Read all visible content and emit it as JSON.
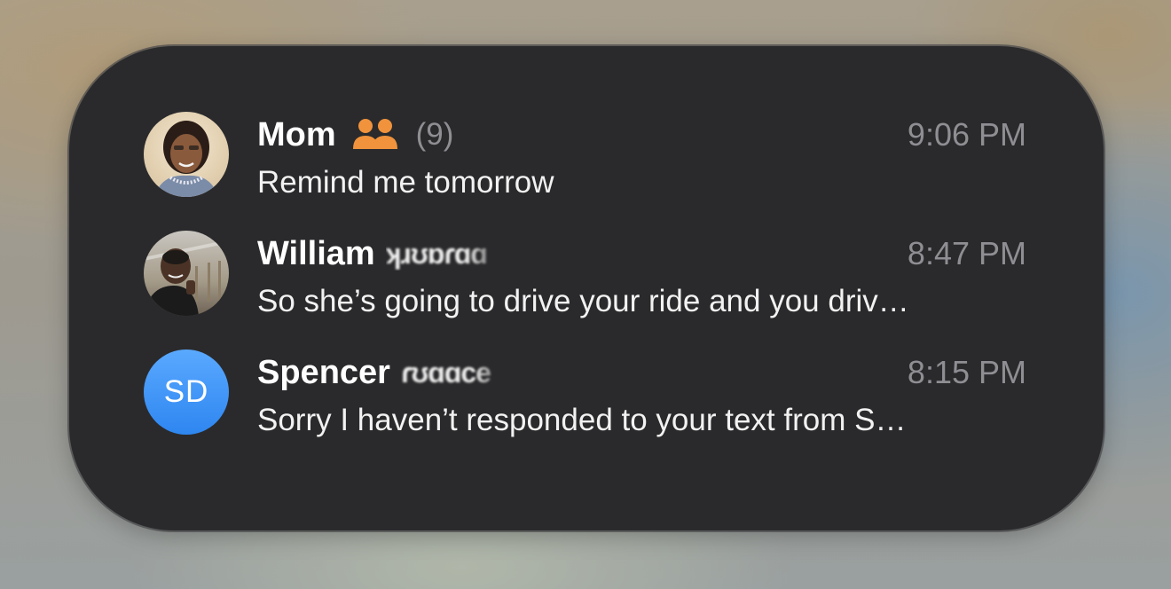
{
  "colors": {
    "widget_background": "#2a2a2c",
    "group_icon": "#f0933c",
    "initials_avatar": "#3b8ef3",
    "secondary_text": "#8e8e93"
  },
  "conversations": [
    {
      "name": "Mom",
      "avatar": "photo-woman",
      "group_icon": "group-people-icon",
      "member_count": "(9)",
      "time": "9:06 PM",
      "preview": "Remind me tomorrow"
    },
    {
      "name": "William",
      "lastname_obscured": "ʞɹʊɒɾɑɑ",
      "avatar": "photo-man",
      "time": "8:47 PM",
      "preview": "So she’s going to drive your ride and you driv…"
    },
    {
      "name": "Spencer",
      "lastname_obscured": "ɾʊɑɑce",
      "avatar_initials": "SD",
      "time": "8:15 PM",
      "preview": "Sorry I haven’t responded to your text from S…"
    }
  ]
}
